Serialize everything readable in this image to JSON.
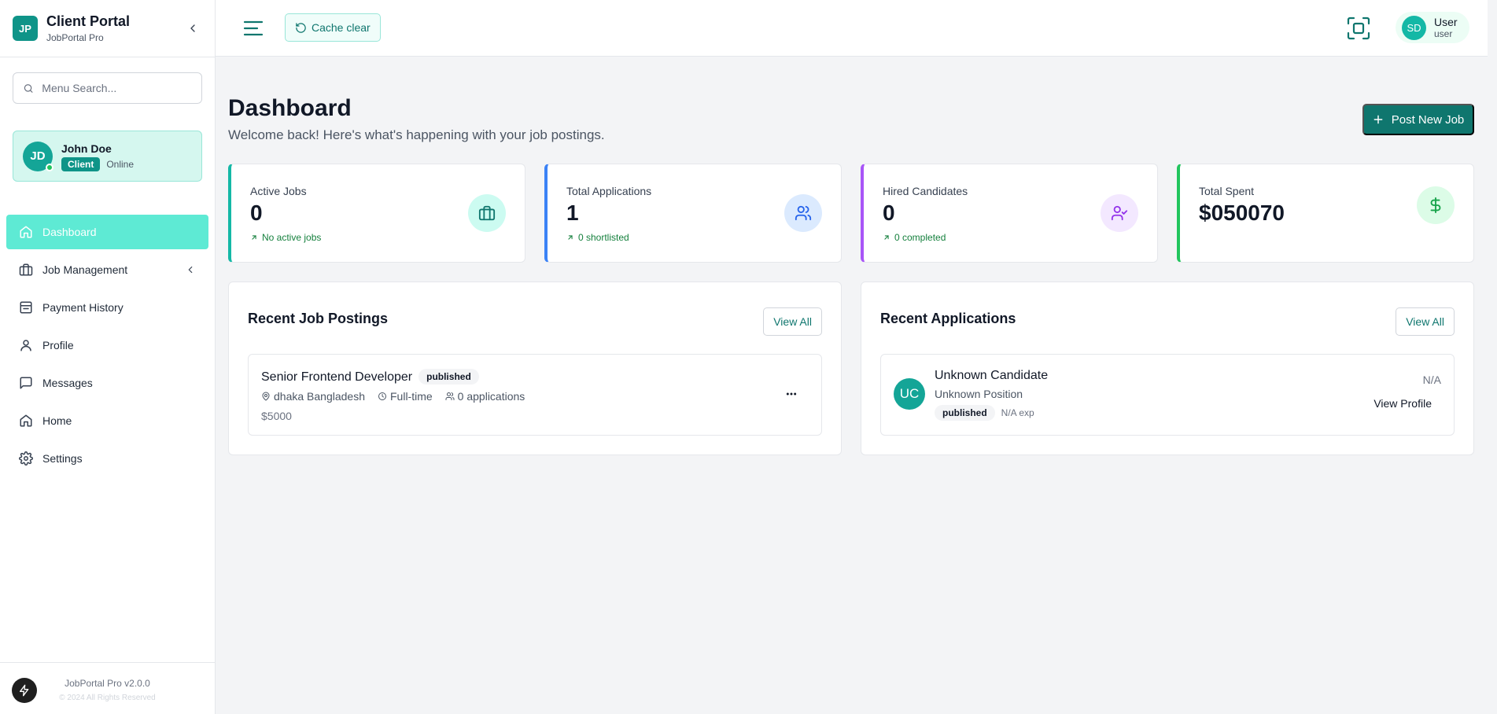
{
  "brand": {
    "logo": "JP",
    "title": "Client Portal",
    "subtitle": "JobPortal Pro"
  },
  "sidebar": {
    "search_placeholder": "Menu Search...",
    "user": {
      "initials": "JD",
      "name": "John Doe",
      "role": "Client",
      "status": "Online"
    },
    "items": [
      {
        "label": "Dashboard",
        "icon": "home-icon",
        "active": true
      },
      {
        "label": "Job Management",
        "icon": "briefcase-icon",
        "has_submenu": true
      },
      {
        "label": "Payment History",
        "icon": "receipt-icon"
      },
      {
        "label": "Profile",
        "icon": "user-icon"
      },
      {
        "label": "Messages",
        "icon": "message-icon"
      },
      {
        "label": "Home",
        "icon": "home-icon"
      },
      {
        "label": "Settings",
        "icon": "gear-icon"
      }
    ],
    "footer": {
      "version": "JobPortal Pro v2.0.0",
      "copyright": "© 2024 All Rights Reserved"
    }
  },
  "header": {
    "cache_label": "Cache clear",
    "user": {
      "initials": "SD",
      "name": "User",
      "role": "user"
    }
  },
  "page": {
    "title": "Dashboard",
    "subtitle": "Welcome back! Here's what's happening with your job postings.",
    "post_button": "Post New Job"
  },
  "stats": [
    {
      "label": "Active Jobs",
      "value": "0",
      "trend": "No active jobs",
      "icon": "briefcase-icon",
      "accent": "#14b8a6",
      "icon_bg": "#ccfbf1",
      "icon_color": "#0f766e"
    },
    {
      "label": "Total Applications",
      "value": "1",
      "trend": "0 shortlisted",
      "icon": "users-icon",
      "accent": "#3b82f6",
      "icon_bg": "#dbeafe",
      "icon_color": "#2563eb"
    },
    {
      "label": "Hired Candidates",
      "value": "0",
      "trend": "0 completed",
      "icon": "user-check-icon",
      "accent": "#a855f7",
      "icon_bg": "#f3e8ff",
      "icon_color": "#9333ea"
    },
    {
      "label": "Total Spent",
      "value": "$050070",
      "trend": "",
      "icon": "dollar-icon",
      "accent": "#22c55e",
      "icon_bg": "#dcfce7",
      "icon_color": "#16a34a"
    }
  ],
  "recent_jobs": {
    "title": "Recent Job Postings",
    "view_all": "View All",
    "items": [
      {
        "title": "Senior Frontend Developer",
        "status": "published",
        "location": "dhaka Bangladesh",
        "type": "Full-time",
        "applications": "0 applications",
        "salary": "$5000"
      }
    ]
  },
  "recent_applications": {
    "title": "Recent Applications",
    "view_all": "View All",
    "items": [
      {
        "initials": "UC",
        "name": "Unknown Candidate",
        "position": "Unknown Position",
        "status": "published",
        "experience": "N/A exp",
        "date": "N/A",
        "action": "View Profile"
      }
    ]
  }
}
